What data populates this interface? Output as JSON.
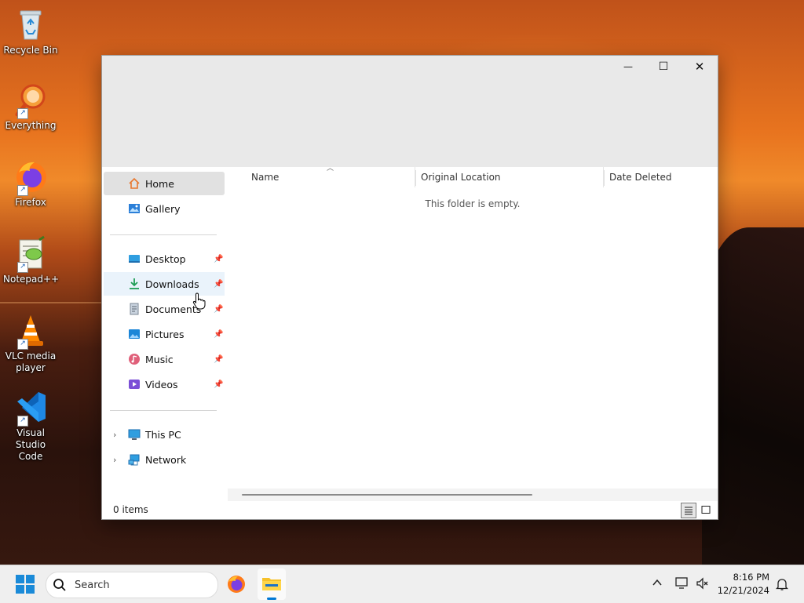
{
  "desktop": {
    "icons": [
      {
        "label": "Recycle Bin",
        "icon": "recycle-bin-icon"
      },
      {
        "label": "Everything",
        "icon": "everything-search-icon"
      },
      {
        "label": "Firefox",
        "icon": "firefox-icon"
      },
      {
        "label": "Notepad++",
        "icon": "notepad-plus-plus-icon"
      },
      {
        "label": "VLC media player",
        "icon": "vlc-cone-icon"
      },
      {
        "label": "Visual Studio Code",
        "icon": "vscode-icon"
      }
    ]
  },
  "window": {
    "controls": {
      "minimize": "—",
      "maximize": "☐",
      "close": "✕"
    },
    "nav": {
      "quick": [
        {
          "label": "Home",
          "icon": "home-icon"
        },
        {
          "label": "Gallery",
          "icon": "gallery-icon"
        }
      ],
      "pinned": [
        {
          "label": "Desktop",
          "icon": "desktop-folder-icon"
        },
        {
          "label": "Downloads",
          "icon": "download-arrow-icon"
        },
        {
          "label": "Documents",
          "icon": "documents-icon"
        },
        {
          "label": "Pictures",
          "icon": "pictures-icon"
        },
        {
          "label": "Music",
          "icon": "music-icon"
        },
        {
          "label": "Videos",
          "icon": "videos-icon"
        }
      ],
      "locations": [
        {
          "label": "This PC",
          "icon": "monitor-icon"
        },
        {
          "label": "Network",
          "icon": "network-icon"
        }
      ]
    },
    "columns": [
      "Name",
      "Original Location",
      "Date Deleted"
    ],
    "empty_message": "This folder is empty.",
    "status": "0 items"
  },
  "taskbar": {
    "search_label": "Search",
    "time": "8:16 PM",
    "date": "12/21/2024"
  },
  "colors": {
    "accent": "#0078d4",
    "nav_selected": "#e1e1e1",
    "nav_hover": "#eaf3fb",
    "titlebar": "#e9e9e9"
  }
}
